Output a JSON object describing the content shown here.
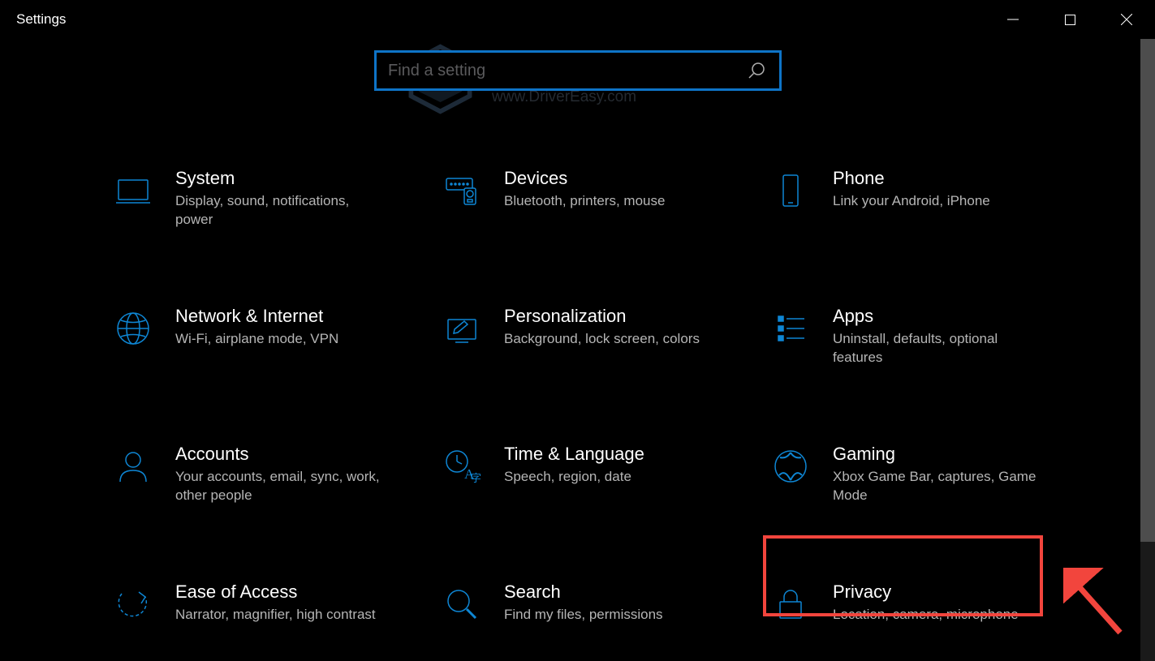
{
  "window": {
    "title": "Settings"
  },
  "search": {
    "placeholder": "Find a setting",
    "value": ""
  },
  "watermark": {
    "title": "driver easy",
    "url": "www.DriverEasy.com"
  },
  "categories": [
    {
      "id": "system",
      "title": "System",
      "description": "Display, sound, notifications, power"
    },
    {
      "id": "devices",
      "title": "Devices",
      "description": "Bluetooth, printers, mouse"
    },
    {
      "id": "phone",
      "title": "Phone",
      "description": "Link your Android, iPhone"
    },
    {
      "id": "network",
      "title": "Network & Internet",
      "description": "Wi-Fi, airplane mode, VPN"
    },
    {
      "id": "personalization",
      "title": "Personalization",
      "description": "Background, lock screen, colors"
    },
    {
      "id": "apps",
      "title": "Apps",
      "description": "Uninstall, defaults, optional features"
    },
    {
      "id": "accounts",
      "title": "Accounts",
      "description": "Your accounts, email, sync, work, other people"
    },
    {
      "id": "time-language",
      "title": "Time & Language",
      "description": "Speech, region, date"
    },
    {
      "id": "gaming",
      "title": "Gaming",
      "description": "Xbox Game Bar, captures, Game Mode"
    },
    {
      "id": "ease-of-access",
      "title": "Ease of Access",
      "description": "Narrator, magnifier, high contrast"
    },
    {
      "id": "search",
      "title": "Search",
      "description": "Find my files, permissions"
    },
    {
      "id": "privacy",
      "title": "Privacy",
      "description": "Location, camera, microphone"
    }
  ],
  "highlighted_category": "privacy",
  "colors": {
    "accent": "#0e86d4",
    "highlight_box": "#f2453d",
    "search_border": "#0e74c7"
  }
}
